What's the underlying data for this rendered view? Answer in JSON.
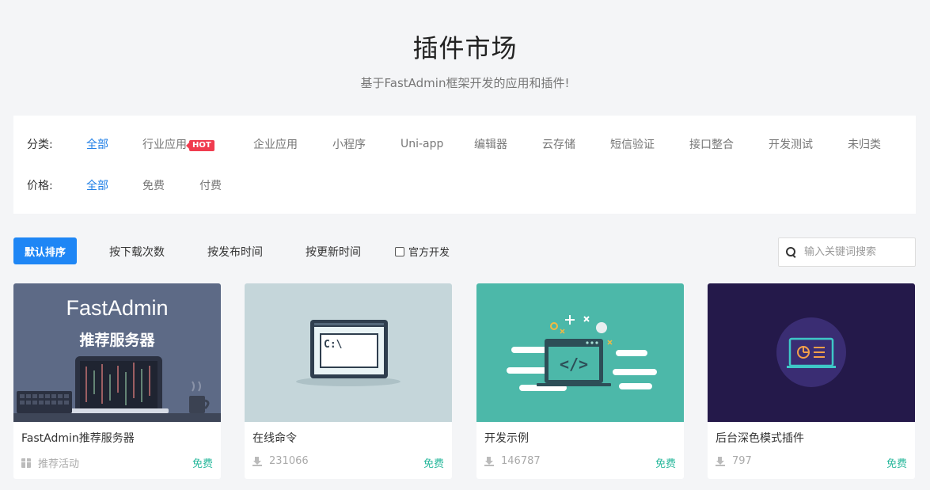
{
  "header": {
    "title": "插件市场",
    "subtitle": "基于FastAdmin框架开发的应用和插件!"
  },
  "filters": {
    "category": {
      "label": "分类:",
      "items": [
        "全部",
        "行业应用",
        "企业应用",
        "小程序",
        "Uni-app",
        "编辑器",
        "云存储",
        "短信验证",
        "接口整合",
        "开发测试",
        "未归类"
      ],
      "hot_badge": "HOT",
      "active_index": 0
    },
    "price": {
      "label": "价格:",
      "items": [
        "全部",
        "免费",
        "付费"
      ],
      "active_index": 0
    }
  },
  "sortbar": {
    "default_label": "默认排序",
    "by_downloads": "按下载次数",
    "by_publish": "按发布时间",
    "by_update": "按更新时间",
    "official_label": "官方开发",
    "search_placeholder": "输入关键词搜索"
  },
  "cards": [
    {
      "name": "FastAdmin推荐服务器",
      "meta": "推荐活动",
      "meta_icon": "gift-icon",
      "price": "免费",
      "thumb_title": "FastAdmin",
      "thumb_subtitle": "推荐服务器",
      "bg": "#5d6a86"
    },
    {
      "name": "在线命令",
      "meta": "231066",
      "meta_icon": "download-icon",
      "price": "免费",
      "thumb_prompt": "C:\\",
      "bg": "#c5d6da"
    },
    {
      "name": "开发示例",
      "meta": "146787",
      "meta_icon": "download-icon",
      "price": "免费",
      "thumb_code": "</>",
      "bg": "#4cb8a9"
    },
    {
      "name": "后台深色模式插件",
      "meta": "797",
      "meta_icon": "download-icon",
      "price": "免费",
      "bg": "#24194a"
    }
  ],
  "colors": {
    "primary": "#1e86f5",
    "active_link": "#1e7ee6",
    "price": "#29b89c",
    "hot": "#f03c4f"
  }
}
